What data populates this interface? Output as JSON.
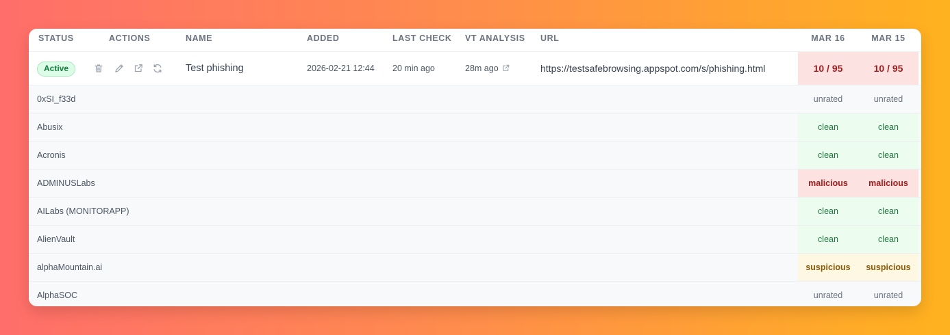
{
  "columns": {
    "status": "STATUS",
    "actions": "ACTIONS",
    "name": "NAME",
    "added": "ADDED",
    "last_check": "LAST CHECK",
    "vt_analysis": "VT ANALYSIS",
    "url": "URL",
    "date1": "MAR 16",
    "date2": "MAR 15"
  },
  "entry": {
    "status": "Active",
    "name": "Test phishing",
    "added": "2026-02-21 12:44",
    "last_check": "20 min ago",
    "vt_analysis": "28m ago",
    "url": "https://testsafebrowsing.appspot.com/s/phishing.html",
    "score1": "10 / 95",
    "score2": "10 / 95",
    "action_icons": [
      "trash-icon",
      "edit-icon",
      "external-link-icon",
      "refresh-icon"
    ]
  },
  "vendors": [
    {
      "name": "0xSI_f33d",
      "r1": "unrated",
      "r2": "unrated"
    },
    {
      "name": "Abusix",
      "r1": "clean",
      "r2": "clean"
    },
    {
      "name": "Acronis",
      "r1": "clean",
      "r2": "clean"
    },
    {
      "name": "ADMINUSLabs",
      "r1": "malicious",
      "r2": "malicious"
    },
    {
      "name": "AILabs (MONITORAPP)",
      "r1": "clean",
      "r2": "clean"
    },
    {
      "name": "AlienVault",
      "r1": "clean",
      "r2": "clean"
    },
    {
      "name": "alphaMountain.ai",
      "r1": "suspicious",
      "r2": "suspicious"
    },
    {
      "name": "AlphaSOC",
      "r1": "unrated",
      "r2": "unrated"
    }
  ],
  "colors": {
    "active_badge": "#dcfce7",
    "clean": "#ecfdf0",
    "malicious": "#fde2e2",
    "suspicious": "#fef8e3"
  }
}
